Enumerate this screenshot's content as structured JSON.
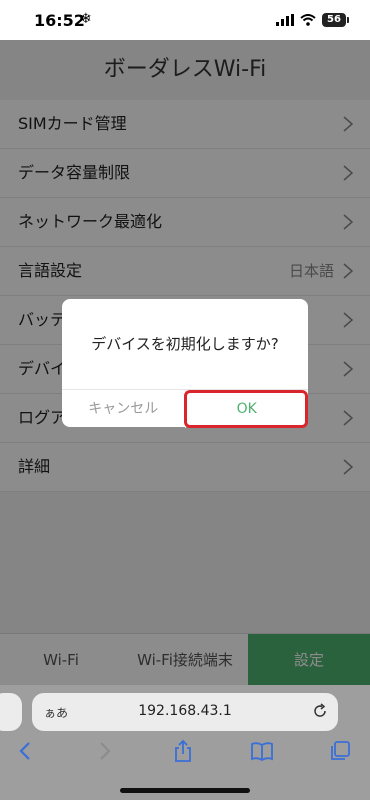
{
  "status_bar": {
    "time": "16:52",
    "battery": "56"
  },
  "app": {
    "title": "ボーダレスWi-Fi",
    "menu": [
      {
        "label": "SIMカード管理",
        "value": ""
      },
      {
        "label": "データ容量制限",
        "value": ""
      },
      {
        "label": "ネットワーク最適化",
        "value": ""
      },
      {
        "label": "言語設定",
        "value": "日本語"
      },
      {
        "label": "バッテ",
        "value": ""
      },
      {
        "label": "デバイ",
        "value": ""
      },
      {
        "label": "ログア",
        "value": ""
      },
      {
        "label": "詳細",
        "value": ""
      }
    ],
    "tabs": [
      "",
      "Wi-Fi",
      "Wi-Fi接続端末",
      "設定"
    ]
  },
  "dialog": {
    "message": "デバイスを初期化しますか?",
    "cancel": "キャンセル",
    "ok": "OK"
  },
  "browser": {
    "aa": "ぁあ",
    "url": "192.168.43.1"
  },
  "colors": {
    "accent": "#4fb271",
    "highlight": "#d9262c",
    "chrome_tint": "#3a6fd8"
  }
}
